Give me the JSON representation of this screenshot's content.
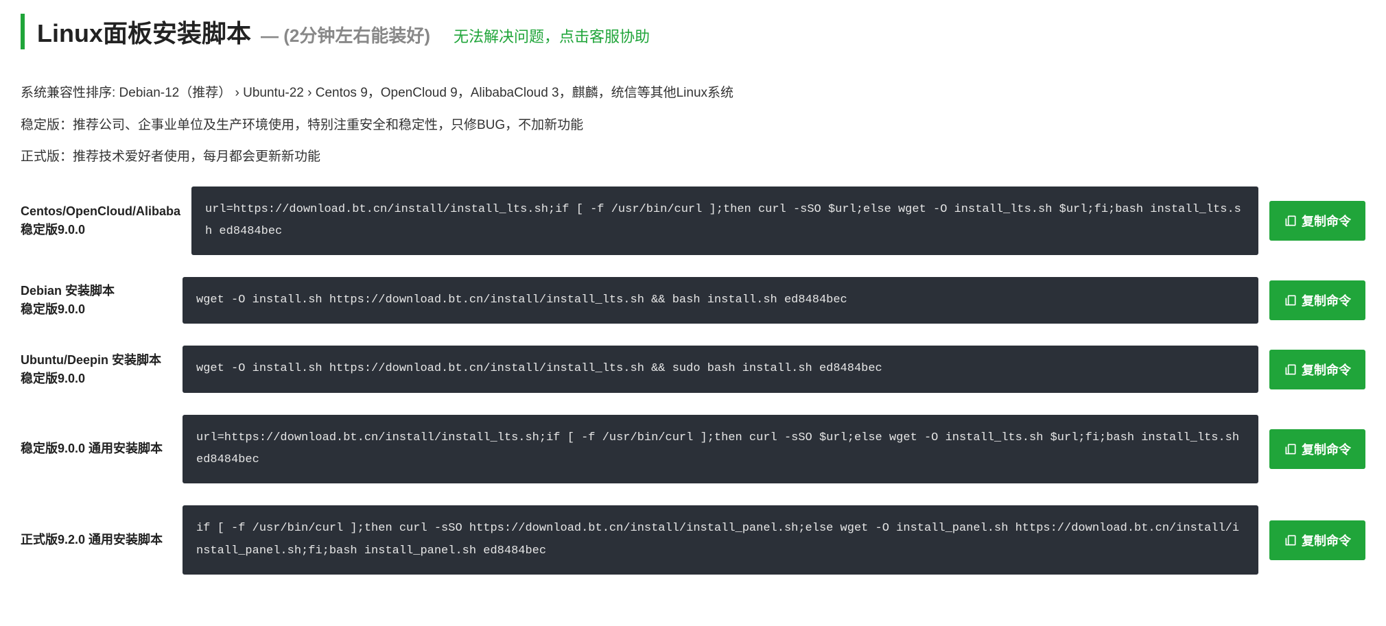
{
  "header": {
    "title": "Linux面板安装脚本",
    "subtitle": "— (2分钟左右能装好)",
    "help_link": "无法解决问题，点击客服协助"
  },
  "desc": {
    "compat": "系统兼容性排序: Debian-12（推荐）  ›  Ubuntu-22  ›  Centos 9，OpenCloud 9，AlibabaCloud 3，麒麟，统信等其他Linux系统",
    "stable": "稳定版：推荐公司、企事业单位及生产环境使用，特别注重安全和稳定性，只修BUG，不加新功能",
    "release": "正式版：推荐技术爱好者使用，每月都会更新新功能"
  },
  "copy_label": "复制命令",
  "scripts": [
    {
      "label_line1": "Centos/OpenCloud/Alibaba",
      "label_line2": "稳定版9.0.0",
      "code": "url=https://download.bt.cn/install/install_lts.sh;if [ -f /usr/bin/curl ];then curl -sSO $url;else wget -O install_lts.sh $url;fi;bash install_lts.sh ed8484bec"
    },
    {
      "label_line1": "Debian 安装脚本",
      "label_line2": "稳定版9.0.0",
      "code": "wget -O install.sh https://download.bt.cn/install/install_lts.sh && bash install.sh ed8484bec"
    },
    {
      "label_line1": "Ubuntu/Deepin 安装脚本",
      "label_line2": "稳定版9.0.0",
      "code": "wget -O install.sh https://download.bt.cn/install/install_lts.sh && sudo bash install.sh ed8484bec"
    },
    {
      "label_line1": "稳定版9.0.0 通用安装脚本",
      "label_line2": "",
      "code": "url=https://download.bt.cn/install/install_lts.sh;if [ -f /usr/bin/curl ];then curl -sSO $url;else wget -O install_lts.sh $url;fi;bash install_lts.sh ed8484bec"
    },
    {
      "label_line1": "正式版9.2.0 通用安装脚本",
      "label_line2": "",
      "code": "if [ -f /usr/bin/curl ];then curl -sSO https://download.bt.cn/install/install_panel.sh;else wget -O install_panel.sh https://download.bt.cn/install/install_panel.sh;fi;bash install_panel.sh ed8484bec"
    }
  ]
}
